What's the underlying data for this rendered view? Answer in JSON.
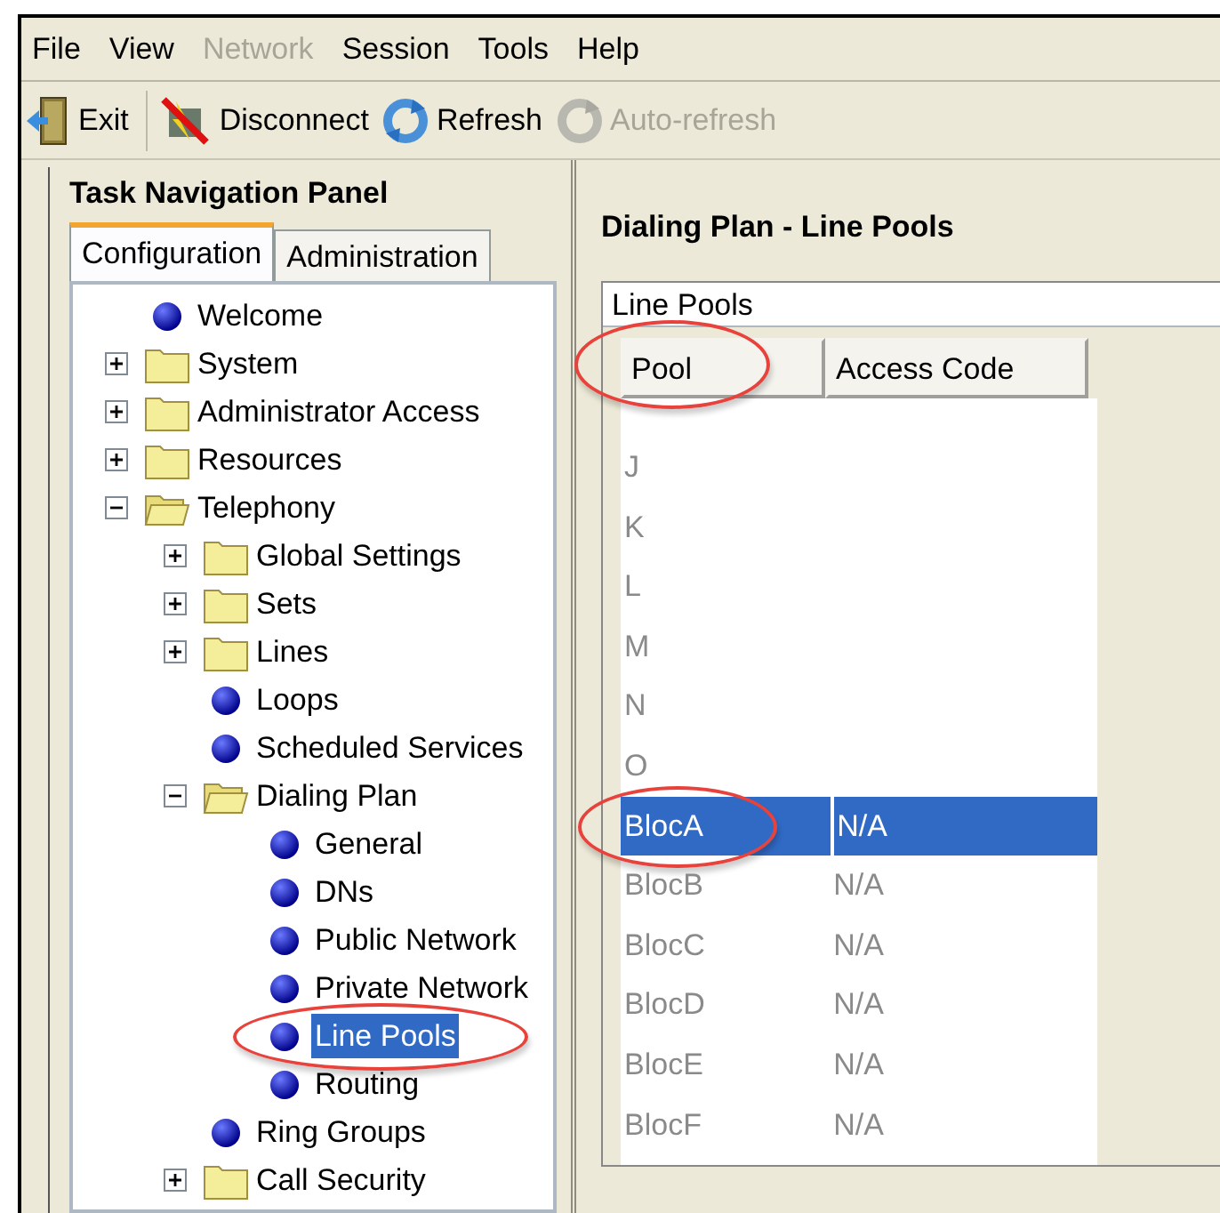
{
  "menu": [
    {
      "label": "File",
      "disabled": false
    },
    {
      "label": "View",
      "disabled": false
    },
    {
      "label": "Network",
      "disabled": true
    },
    {
      "label": "Session",
      "disabled": false
    },
    {
      "label": "Tools",
      "disabled": false
    },
    {
      "label": "Help",
      "disabled": false
    }
  ],
  "toolbar": [
    {
      "label": "Exit",
      "kind": "exit",
      "disabled": false
    },
    {
      "label": "Disconnect",
      "kind": "disconnect",
      "disabled": false
    },
    {
      "label": "Refresh",
      "kind": "refresh",
      "disabled": false
    },
    {
      "label": "Auto-refresh",
      "kind": "autorefresh",
      "disabled": true
    }
  ],
  "nav_panel": {
    "title": "Task Navigation Panel",
    "tabs": [
      {
        "label": "Configuration",
        "selected": true
      },
      {
        "label": "Administration",
        "selected": false
      }
    ],
    "tree": [
      {
        "label": "Welcome",
        "kind": "leaf",
        "selected": false,
        "circled": false
      },
      {
        "label": "System",
        "kind": "folder",
        "expanded": false,
        "selected": false,
        "circled": false
      },
      {
        "label": "Administrator Access",
        "kind": "folder",
        "expanded": false,
        "selected": false,
        "circled": false
      },
      {
        "label": "Resources",
        "kind": "folder",
        "expanded": false,
        "selected": false,
        "circled": false
      },
      {
        "label": "Telephony",
        "kind": "folder",
        "expanded": true,
        "selected": false,
        "circled": false,
        "children": [
          {
            "label": "Global Settings",
            "kind": "folder",
            "expanded": false,
            "selected": false,
            "circled": false
          },
          {
            "label": "Sets",
            "kind": "folder",
            "expanded": false,
            "selected": false,
            "circled": false
          },
          {
            "label": "Lines",
            "kind": "folder",
            "expanded": false,
            "selected": false,
            "circled": false
          },
          {
            "label": "Loops",
            "kind": "leaf",
            "selected": false,
            "circled": false
          },
          {
            "label": "Scheduled Services",
            "kind": "leaf",
            "selected": false,
            "circled": false
          },
          {
            "label": "Dialing Plan",
            "kind": "folder",
            "expanded": true,
            "selected": false,
            "circled": false,
            "children": [
              {
                "label": "General",
                "kind": "leaf",
                "selected": false,
                "circled": false
              },
              {
                "label": "DNs",
                "kind": "leaf",
                "selected": false,
                "circled": false
              },
              {
                "label": "Public Network",
                "kind": "leaf",
                "selected": false,
                "circled": false
              },
              {
                "label": "Private Network",
                "kind": "leaf",
                "selected": false,
                "circled": false
              },
              {
                "label": "Line Pools",
                "kind": "leaf",
                "selected": true,
                "circled": true
              },
              {
                "label": "Routing",
                "kind": "leaf",
                "selected": false,
                "circled": false
              }
            ]
          },
          {
            "label": "Ring Groups",
            "kind": "leaf",
            "selected": false,
            "circled": false
          },
          {
            "label": "Call Security",
            "kind": "folder",
            "expanded": false,
            "selected": false,
            "circled": false
          }
        ]
      }
    ]
  },
  "content": {
    "title": "Dialing Plan - Line Pools",
    "table": {
      "title": "Line Pools",
      "columns": [
        {
          "label": "Pool",
          "circled": true
        },
        {
          "label": "Access Code",
          "circled": false
        }
      ],
      "rows": [
        {
          "cells": [
            "J"
          ],
          "selected": false,
          "circled": false
        },
        {
          "cells": [
            "K"
          ],
          "selected": false,
          "circled": false
        },
        {
          "cells": [
            "L"
          ],
          "selected": false,
          "circled": false
        },
        {
          "cells": [
            "M"
          ],
          "selected": false,
          "circled": false
        },
        {
          "cells": [
            "N"
          ],
          "selected": false,
          "circled": false
        },
        {
          "cells": [
            "O"
          ],
          "selected": false,
          "circled": false
        },
        {
          "cells": [
            "BlocA",
            "N/A"
          ],
          "selected": true,
          "circled": true
        },
        {
          "cells": [
            "BlocB",
            "N/A"
          ],
          "selected": false,
          "circled": false
        },
        {
          "cells": [
            "BlocC",
            "N/A"
          ],
          "selected": false,
          "circled": false
        },
        {
          "cells": [
            "BlocD",
            "N/A"
          ],
          "selected": false,
          "circled": false
        },
        {
          "cells": [
            "BlocE",
            "N/A"
          ],
          "selected": false,
          "circled": false
        },
        {
          "cells": [
            "BlocF",
            "N/A"
          ],
          "selected": false,
          "circled": false
        }
      ]
    }
  }
}
